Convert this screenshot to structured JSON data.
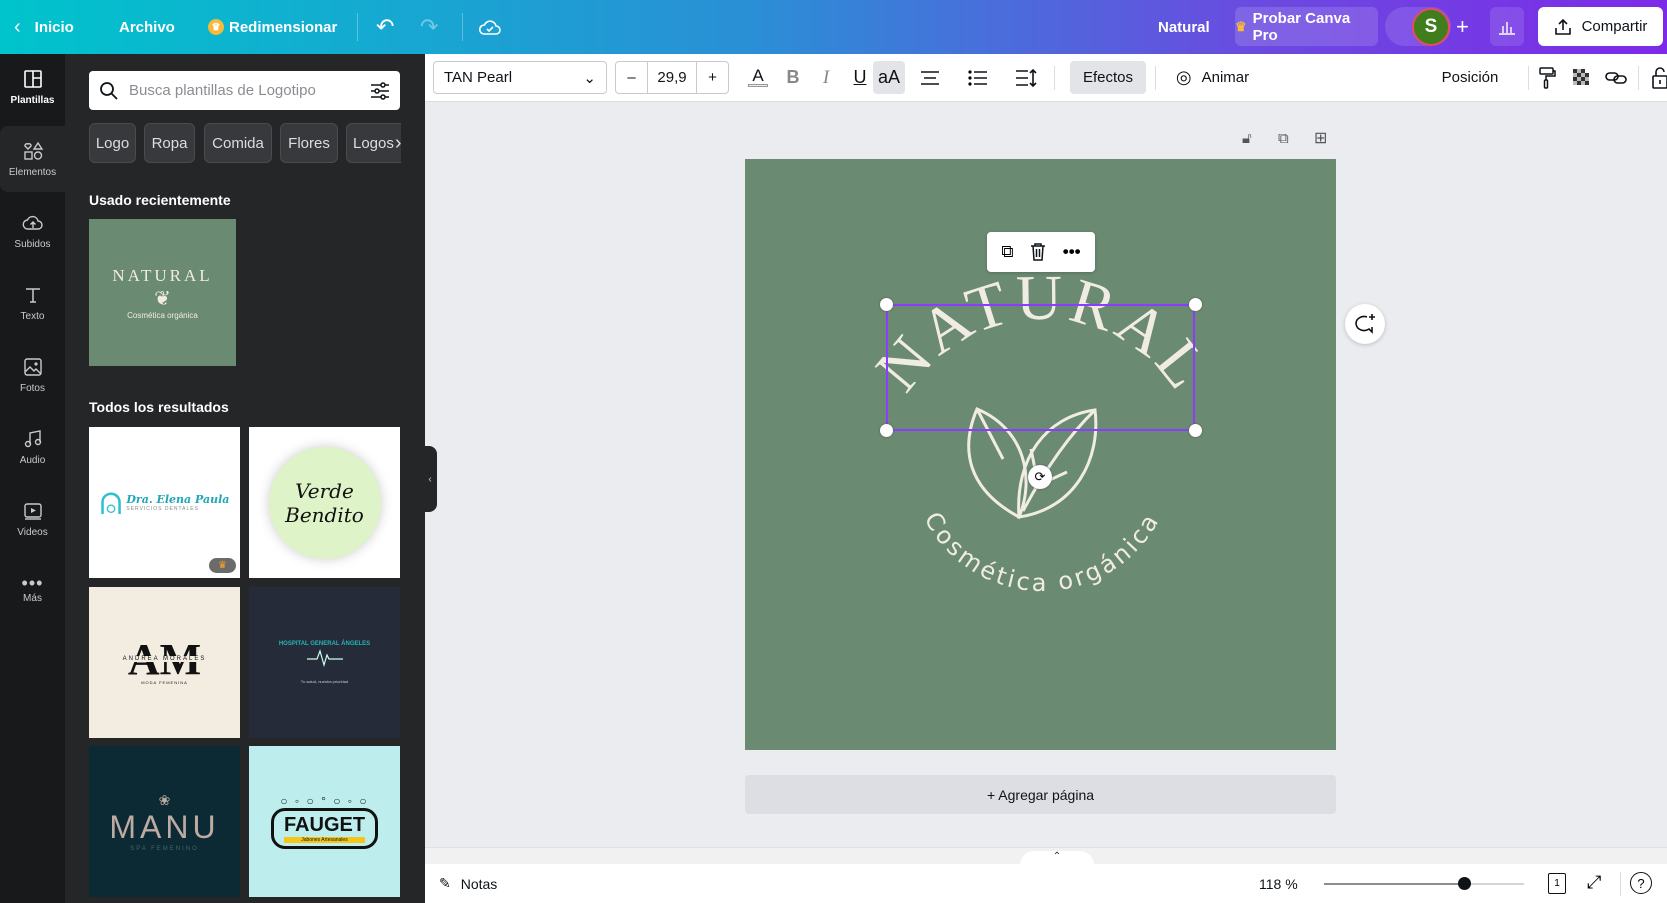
{
  "topbar": {
    "back": "Inicio",
    "file": "Archivo",
    "resize": "Redimensionar",
    "doc_title": "Natural",
    "pro": "Probar Canva Pro",
    "avatar": "S",
    "share": "Compartir"
  },
  "rail": [
    {
      "label": "Plantillas",
      "icon": "templates-icon"
    },
    {
      "label": "Elementos",
      "icon": "elements-icon"
    },
    {
      "label": "Subidos",
      "icon": "upload-icon"
    },
    {
      "label": "Texto",
      "icon": "text-icon"
    },
    {
      "label": "Fotos",
      "icon": "photos-icon"
    },
    {
      "label": "Audio",
      "icon": "audio-icon"
    },
    {
      "label": "Videos",
      "icon": "video-icon"
    },
    {
      "label": "Más",
      "icon": "more-icon"
    }
  ],
  "panel": {
    "search_placeholder": "Busca plantillas de Logotipo",
    "chips": [
      "Logo",
      "Ropa",
      "Comida",
      "Flores",
      "Logos"
    ],
    "recent_heading": "Usado recientemente",
    "results_heading": "Todos los resultados",
    "recent": {
      "title": "NATURAL",
      "subtitle": "Cosmética orgánica"
    },
    "results": [
      {
        "title": "Dra. Elena Paula",
        "subtitle": "SERVICIOS DENTALES",
        "pro": true
      },
      {
        "title": "Verde",
        "subtitle": "Bendito"
      },
      {
        "title": "AM",
        "subtitle": "ANDREA MORALES",
        "extra": "MODA FEMENINA"
      },
      {
        "title": "HOSPITAL GENERAL ÁNGELES",
        "subtitle": "Tu salud, nuestra prioridad"
      },
      {
        "title": "MANU",
        "subtitle": "SPA FEMENINO"
      },
      {
        "title": "FAUGET",
        "subtitle": "Jabones Artesanales"
      }
    ]
  },
  "toolbar": {
    "font": "TAN Pearl",
    "size": "29,9",
    "effects": "Efectos",
    "animate": "Animar",
    "position": "Posición"
  },
  "canvas": {
    "title": "NATURAL",
    "subtitle": "Cosmética orgánica",
    "add_page": "+ Agregar página",
    "colors": {
      "page": "#6b8a72",
      "ink": "#f1ece3",
      "selection": "#8b3dff"
    }
  },
  "footer": {
    "notes": "Notas",
    "zoom": "118 %",
    "zoom_level": 0.7,
    "page_number": "1"
  }
}
